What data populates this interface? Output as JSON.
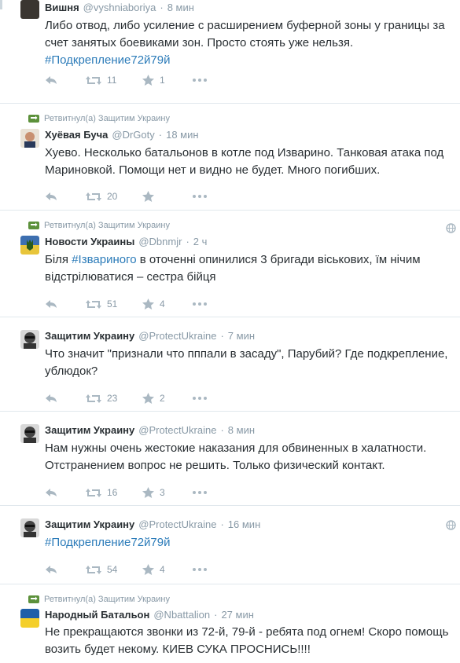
{
  "tweets": [
    {
      "retweeted_by": "",
      "name": "Вишня",
      "handle": "@vyshniaboriya",
      "time": "8 мин",
      "text_before": "Либо отвод, либо усиление с расширением буферной зоны у границы за счет занятых боевиками зон. Просто стоять уже нельзя.",
      "hashtag": "#Подкрепление72й79й",
      "text_after": "",
      "retweets": "11",
      "favorites": "1",
      "globe": false,
      "avatar_color": "#3a3530"
    },
    {
      "retweeted_by": "Ретвитнул(а) Защитим Украину",
      "name": "Хуёвая Буча",
      "handle": "@DrGoty",
      "time": "18 мин",
      "text_before": "Хуево. Несколько батальонов в котле под Изварино. Танковая атака под Мариновкой. Помощи нет и видно не будет. Много погибших.",
      "hashtag": "",
      "text_after": "",
      "retweets": "20",
      "favorites": "",
      "globe": false,
      "avatar_color": "#c89070"
    },
    {
      "retweeted_by": "Ретвитнул(а) Защитим Украину",
      "name": "Новости Украины",
      "handle": "@Dbnmjr",
      "time": "2 ч",
      "text_before": "Біля ",
      "hashtag": "#Ізвариного",
      "text_after": " в оточенні опинилися 3 бригади віськових, їм нічим відстрілюватися – сестра бійця",
      "retweets": "51",
      "favorites": "4",
      "globe": true,
      "avatar_color": "#3d6fb0"
    },
    {
      "retweeted_by": "",
      "name": "Защитим Украину",
      "handle": "@ProtectUkraine",
      "time": "7 мин",
      "text_before": "Что значит \"признали что пппали в засаду\", Парубий? Где подкрепление, ублюдок?",
      "hashtag": "",
      "text_after": "",
      "retweets": "23",
      "favorites": "2",
      "globe": false,
      "avatar_color": "#555"
    },
    {
      "retweeted_by": "",
      "name": "Защитим Украину",
      "handle": "@ProtectUkraine",
      "time": "8 мин",
      "text_before": "Нам нужны очень жестокие наказания для обвиненных в халатности. Отстранением вопрос не решить. Только физический контакт.",
      "hashtag": "",
      "text_after": "",
      "retweets": "16",
      "favorites": "3",
      "globe": false,
      "avatar_color": "#555"
    },
    {
      "retweeted_by": "",
      "name": "Защитим Украину",
      "handle": "@ProtectUkraine",
      "time": "16 мин",
      "text_before": "",
      "hashtag": "#Подкрепление72й79й",
      "text_after": "",
      "retweets": "54",
      "favorites": "4",
      "globe": true,
      "avatar_color": "#555"
    },
    {
      "retweeted_by": "Ретвитнул(а) Защитим Украину",
      "name": "Народный Батальон",
      "handle": "@Nbattalion",
      "time": "27 мин",
      "text_before": "Не прекращаются звонки из 72-й, 79-й - ребята под огнем! Скоро помощь возить будет некому. КИЕВ СУКА ПРОСНИСЬ!!!!",
      "hashtag": "",
      "text_after": "",
      "retweets": "",
      "favorites": "",
      "globe": false,
      "avatar_color": "#1f5fa8"
    }
  ]
}
